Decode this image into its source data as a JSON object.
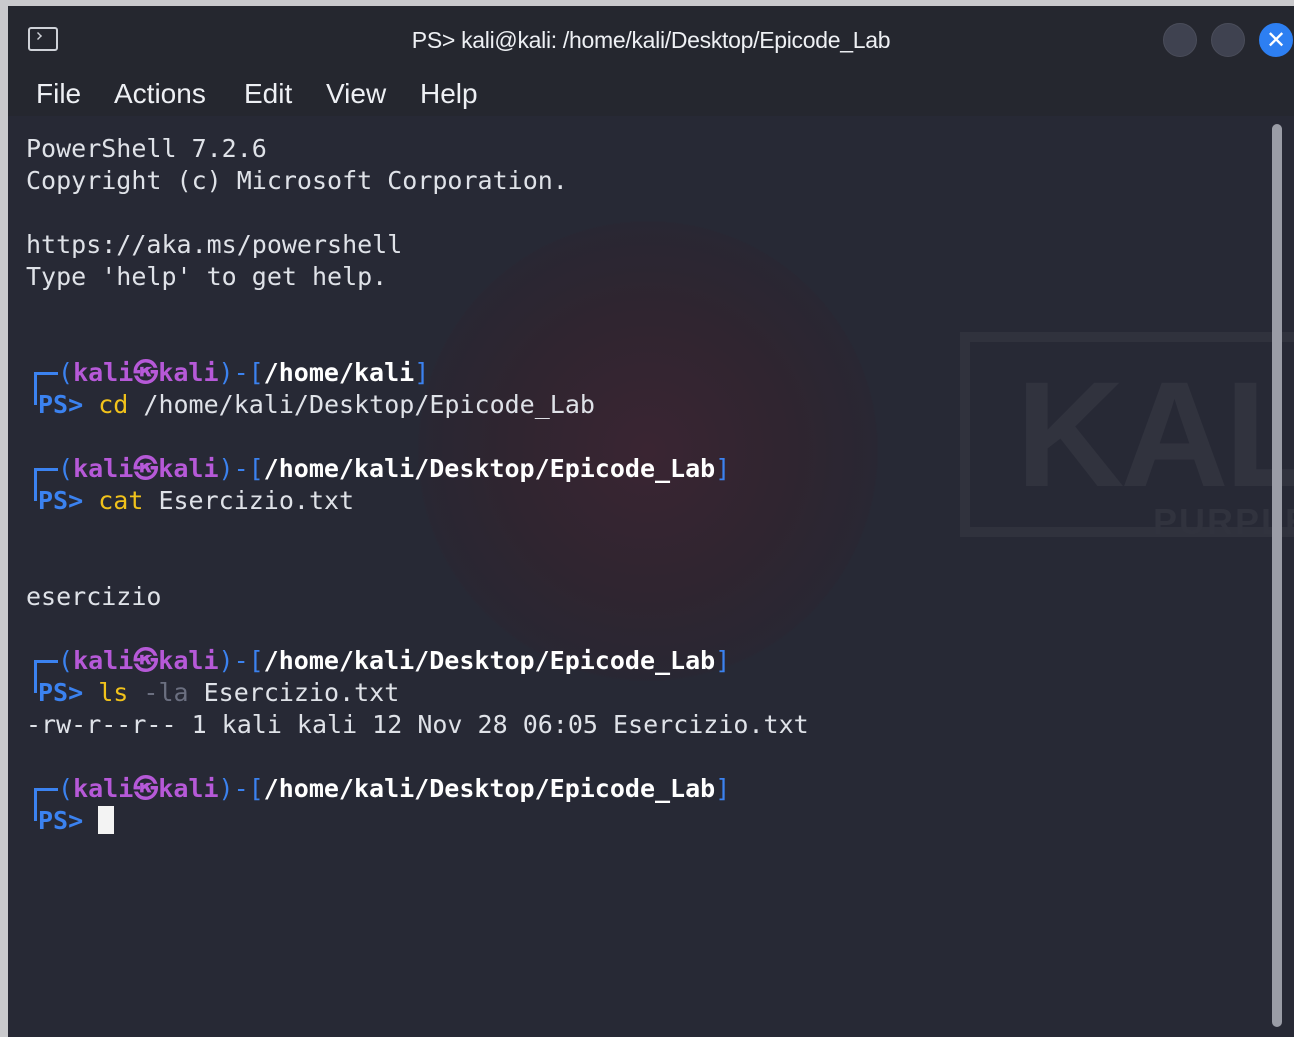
{
  "window": {
    "title": "PS> kali@kali: /home/kali/Desktop/Epicode_Lab",
    "close_glyph": "✕"
  },
  "menu": [
    "File",
    "Actions",
    "Edit",
    "View",
    "Help"
  ],
  "terminal": {
    "banner": [
      "PowerShell 7.2.6",
      "Copyright (c) Microsoft Corporation.",
      "https://aka.ms/powershell",
      "Type 'help' to get help."
    ],
    "prompts": [
      {
        "open": "(",
        "user": "kali",
        "at": "㉿",
        "host": "kali",
        "mid": ")-[",
        "path": "/home/kali",
        "close": "]",
        "ps": "PS>",
        "cmd": "cd",
        "args": "/home/kali/Desktop/Epicode_Lab",
        "flag": ""
      },
      {
        "open": "(",
        "user": "kali",
        "at": "㉿",
        "host": "kali",
        "mid": ")-[",
        "path": "/home/kali/Desktop/Epicode_Lab",
        "close": "]",
        "ps": "PS>",
        "cmd": "cat",
        "args": "Esercizio.txt",
        "flag": ""
      },
      {
        "open": "(",
        "user": "kali",
        "at": "㉿",
        "host": "kali",
        "mid": ")-[",
        "path": "/home/kali/Desktop/Epicode_Lab",
        "close": "]",
        "ps": "PS>",
        "cmd": "ls",
        "args": "Esercizio.txt",
        "flag": "-la"
      },
      {
        "open": "(",
        "user": "kali",
        "at": "㉿",
        "host": "kali",
        "mid": ")-[",
        "path": "/home/kali/Desktop/Epicode_Lab",
        "close": "]",
        "ps": "PS>",
        "cmd": "",
        "args": "",
        "flag": ""
      }
    ],
    "outputs": {
      "cat": "esercizio",
      "ls": "-rw-r--r-- 1 kali kali 12 Nov 28 06:05 Esercizio.txt"
    }
  },
  "wallpaper": {
    "word": "KALI",
    "sub": "PURPLE"
  },
  "colors": {
    "terminal_bg": "#272935",
    "prompt_blue": "#3b82f0",
    "user_purple": "#b659d8",
    "command_yellow": "#f1c21b",
    "close_button": "#2d7ff2"
  }
}
